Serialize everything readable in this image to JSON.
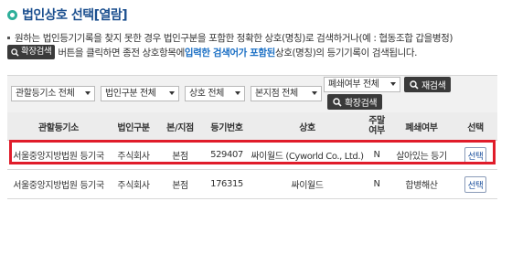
{
  "title": "법인상호 선택[열람]",
  "guide": {
    "line1": "원하는 법인등기기록을 찾지 못한 경우 법인구분을 포함한 정확한 상호(명칭)로 검색하거나(예 : 협동조합 갑을병정)",
    "expand_btn": "확장검색",
    "line2_pre": "버튼을 클릭하면 종전 상호항목에 ",
    "line2_hl": "입력한 검색어가 포함된",
    "line2_post": " 상호(명칭)의 등기기록이 검색됩니다."
  },
  "filters": {
    "registry": "관할등기소 전체",
    "corp_type": "법인구분 전체",
    "sangho": "상호 전체",
    "branch": "본지점 전체",
    "closure": "폐쇄여부 전체",
    "research_btn": "재검색",
    "expand_btn": "확장검색"
  },
  "table": {
    "headers": [
      "관할등기소",
      "법인구분",
      "본/지점",
      "등기번호",
      "상호",
      "주말",
      "여부",
      "폐쇄여부",
      "선택"
    ],
    "rows": [
      {
        "registry": "서울중앙지방법원 등기국",
        "type": "주식회사",
        "branch": "본점",
        "no": "529407",
        "name": "싸이월드 (Cyworld Co., Ltd.)",
        "weekend": "N",
        "closure": "살아있는 등기",
        "select": "선택"
      },
      {
        "registry": "서울중앙지방법원 등기국",
        "type": "주식회사",
        "branch": "본점",
        "no": "176315",
        "name": "싸이월드",
        "weekend": "N",
        "closure": "합병해산",
        "select": "선택"
      }
    ]
  },
  "colors": {
    "accent": "#1b4f8f",
    "highlight": "#e01c2a",
    "bullet": "#2eaf9a"
  }
}
